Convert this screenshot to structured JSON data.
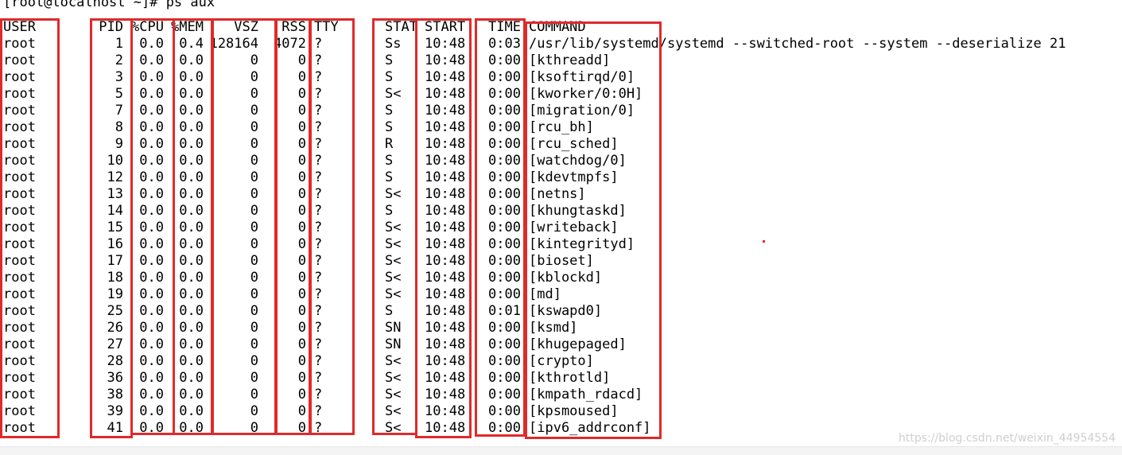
{
  "terminal": {
    "prompt": "[root@localhost ~]# ps aux",
    "headers": {
      "user": "USER",
      "pid": "PID",
      "cpu": "%CPU",
      "mem": "%MEM",
      "vsz": "VSZ",
      "rss": "RSS",
      "tty": "TTY",
      "stat": "STAT",
      "start": "START",
      "time": "TIME",
      "command": "COMMAND"
    },
    "rows": [
      {
        "user": "root",
        "pid": "1",
        "cpu": "0.0",
        "mem": "0.4",
        "vsz": "128164",
        "rss": "4072",
        "tty": "?",
        "stat": "Ss",
        "start": "10:48",
        "time": "0:03",
        "command": "/usr/lib/systemd/systemd --switched-root --system --deserialize 21"
      },
      {
        "user": "root",
        "pid": "2",
        "cpu": "0.0",
        "mem": "0.0",
        "vsz": "0",
        "rss": "0",
        "tty": "?",
        "stat": "S",
        "start": "10:48",
        "time": "0:00",
        "command": "[kthreadd]"
      },
      {
        "user": "root",
        "pid": "3",
        "cpu": "0.0",
        "mem": "0.0",
        "vsz": "0",
        "rss": "0",
        "tty": "?",
        "stat": "S",
        "start": "10:48",
        "time": "0:00",
        "command": "[ksoftirqd/0]"
      },
      {
        "user": "root",
        "pid": "5",
        "cpu": "0.0",
        "mem": "0.0",
        "vsz": "0",
        "rss": "0",
        "tty": "?",
        "stat": "S<",
        "start": "10:48",
        "time": "0:00",
        "command": "[kworker/0:0H]"
      },
      {
        "user": "root",
        "pid": "7",
        "cpu": "0.0",
        "mem": "0.0",
        "vsz": "0",
        "rss": "0",
        "tty": "?",
        "stat": "S",
        "start": "10:48",
        "time": "0:00",
        "command": "[migration/0]"
      },
      {
        "user": "root",
        "pid": "8",
        "cpu": "0.0",
        "mem": "0.0",
        "vsz": "0",
        "rss": "0",
        "tty": "?",
        "stat": "S",
        "start": "10:48",
        "time": "0:00",
        "command": "[rcu_bh]"
      },
      {
        "user": "root",
        "pid": "9",
        "cpu": "0.0",
        "mem": "0.0",
        "vsz": "0",
        "rss": "0",
        "tty": "?",
        "stat": "R",
        "start": "10:48",
        "time": "0:00",
        "command": "[rcu_sched]"
      },
      {
        "user": "root",
        "pid": "10",
        "cpu": "0.0",
        "mem": "0.0",
        "vsz": "0",
        "rss": "0",
        "tty": "?",
        "stat": "S",
        "start": "10:48",
        "time": "0:00",
        "command": "[watchdog/0]"
      },
      {
        "user": "root",
        "pid": "12",
        "cpu": "0.0",
        "mem": "0.0",
        "vsz": "0",
        "rss": "0",
        "tty": "?",
        "stat": "S",
        "start": "10:48",
        "time": "0:00",
        "command": "[kdevtmpfs]"
      },
      {
        "user": "root",
        "pid": "13",
        "cpu": "0.0",
        "mem": "0.0",
        "vsz": "0",
        "rss": "0",
        "tty": "?",
        "stat": "S<",
        "start": "10:48",
        "time": "0:00",
        "command": "[netns]"
      },
      {
        "user": "root",
        "pid": "14",
        "cpu": "0.0",
        "mem": "0.0",
        "vsz": "0",
        "rss": "0",
        "tty": "?",
        "stat": "S",
        "start": "10:48",
        "time": "0:00",
        "command": "[khungtaskd]"
      },
      {
        "user": "root",
        "pid": "15",
        "cpu": "0.0",
        "mem": "0.0",
        "vsz": "0",
        "rss": "0",
        "tty": "?",
        "stat": "S<",
        "start": "10:48",
        "time": "0:00",
        "command": "[writeback]"
      },
      {
        "user": "root",
        "pid": "16",
        "cpu": "0.0",
        "mem": "0.0",
        "vsz": "0",
        "rss": "0",
        "tty": "?",
        "stat": "S<",
        "start": "10:48",
        "time": "0:00",
        "command": "[kintegrityd]"
      },
      {
        "user": "root",
        "pid": "17",
        "cpu": "0.0",
        "mem": "0.0",
        "vsz": "0",
        "rss": "0",
        "tty": "?",
        "stat": "S<",
        "start": "10:48",
        "time": "0:00",
        "command": "[bioset]"
      },
      {
        "user": "root",
        "pid": "18",
        "cpu": "0.0",
        "mem": "0.0",
        "vsz": "0",
        "rss": "0",
        "tty": "?",
        "stat": "S<",
        "start": "10:48",
        "time": "0:00",
        "command": "[kblockd]"
      },
      {
        "user": "root",
        "pid": "19",
        "cpu": "0.0",
        "mem": "0.0",
        "vsz": "0",
        "rss": "0",
        "tty": "?",
        "stat": "S<",
        "start": "10:48",
        "time": "0:00",
        "command": "[md]"
      },
      {
        "user": "root",
        "pid": "25",
        "cpu": "0.0",
        "mem": "0.0",
        "vsz": "0",
        "rss": "0",
        "tty": "?",
        "stat": "S",
        "start": "10:48",
        "time": "0:01",
        "command": "[kswapd0]"
      },
      {
        "user": "root",
        "pid": "26",
        "cpu": "0.0",
        "mem": "0.0",
        "vsz": "0",
        "rss": "0",
        "tty": "?",
        "stat": "SN",
        "start": "10:48",
        "time": "0:00",
        "command": "[ksmd]"
      },
      {
        "user": "root",
        "pid": "27",
        "cpu": "0.0",
        "mem": "0.0",
        "vsz": "0",
        "rss": "0",
        "tty": "?",
        "stat": "SN",
        "start": "10:48",
        "time": "0:00",
        "command": "[khugepaged]"
      },
      {
        "user": "root",
        "pid": "28",
        "cpu": "0.0",
        "mem": "0.0",
        "vsz": "0",
        "rss": "0",
        "tty": "?",
        "stat": "S<",
        "start": "10:48",
        "time": "0:00",
        "command": "[crypto]"
      },
      {
        "user": "root",
        "pid": "36",
        "cpu": "0.0",
        "mem": "0.0",
        "vsz": "0",
        "rss": "0",
        "tty": "?",
        "stat": "S<",
        "start": "10:48",
        "time": "0:00",
        "command": "[kthrotld]"
      },
      {
        "user": "root",
        "pid": "38",
        "cpu": "0.0",
        "mem": "0.0",
        "vsz": "0",
        "rss": "0",
        "tty": "?",
        "stat": "S<",
        "start": "10:48",
        "time": "0:00",
        "command": "[kmpath_rdacd]"
      },
      {
        "user": "root",
        "pid": "39",
        "cpu": "0.0",
        "mem": "0.0",
        "vsz": "0",
        "rss": "0",
        "tty": "?",
        "stat": "S<",
        "start": "10:48",
        "time": "0:00",
        "command": "[kpsmoused]"
      },
      {
        "user": "root",
        "pid": "41",
        "cpu": "0.0",
        "mem": "0.0",
        "vsz": "0",
        "rss": "0",
        "tty": "?",
        "stat": "S<",
        "start": "10:48",
        "time": "0:00",
        "command": "[ipv6_addrconf]"
      }
    ]
  },
  "watermark": "https://blog.csdn.net/weixin_44954554",
  "colors": {
    "highlight": "#e02a2a",
    "background": "#ffffff",
    "text": "#000000"
  }
}
